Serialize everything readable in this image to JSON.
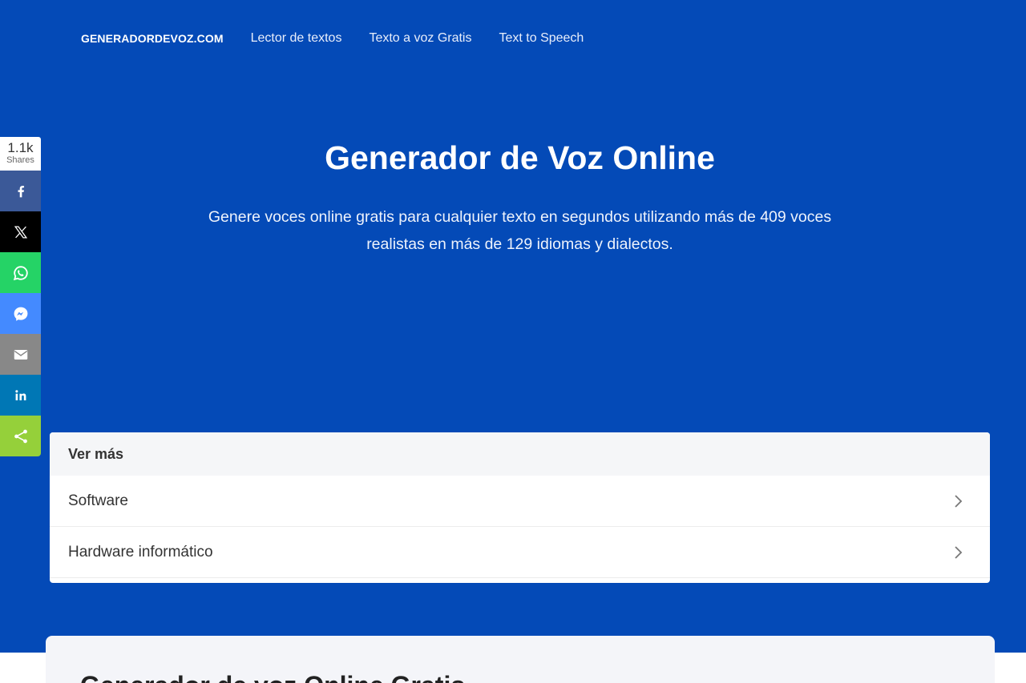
{
  "nav": {
    "brand": "GENERADORDEVOZ.COM",
    "links": [
      "Lector de textos",
      "Texto a voz Gratis",
      "Text to Speech"
    ]
  },
  "hero": {
    "title": "Generador de Voz Online",
    "subtitle_line1": "Genere voces online gratis para cualquier texto en segundos utilizando más de 409 voces",
    "subtitle_line2": "realistas en más de 129 idiomas y dialectos."
  },
  "share": {
    "count": "1.1k",
    "count_label": "Shares",
    "buttons": [
      {
        "icon": "facebook-icon",
        "color": "#3b5998"
      },
      {
        "icon": "x-icon",
        "color": "#000000"
      },
      {
        "icon": "whatsapp-icon",
        "color": "#25d366"
      },
      {
        "icon": "messenger-icon",
        "color": "#448aff"
      },
      {
        "icon": "email-icon",
        "color": "#888888"
      },
      {
        "icon": "linkedin-icon",
        "color": "#0077b5"
      },
      {
        "icon": "share-icon",
        "color": "#95d03a"
      }
    ]
  },
  "more_card": {
    "header": "Ver más",
    "items": [
      "Software",
      "Hardware informático"
    ]
  },
  "section": {
    "heading": "Generador de voz Online Gratis"
  },
  "colors": {
    "hero_bg": "#044ab7",
    "card_header_bg": "#f5f6f8",
    "panel_bg": "#f4f5f9"
  }
}
